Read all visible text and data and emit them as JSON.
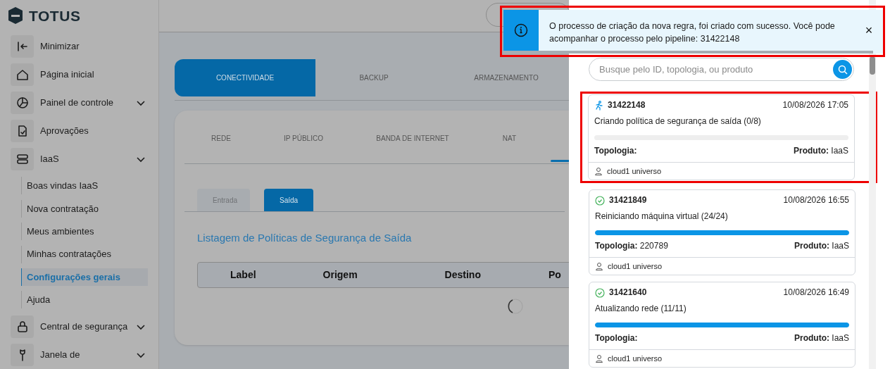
{
  "logo": {
    "text": "TOTUS"
  },
  "sidebar": {
    "items": [
      {
        "kind": "collapse",
        "label": "Minimizar",
        "expandable": false
      },
      {
        "kind": "home",
        "label": "Página inicial",
        "expandable": false
      },
      {
        "kind": "chart",
        "label": "Painel de controle",
        "expandable": true
      },
      {
        "kind": "approval",
        "label": "Aprovações",
        "expandable": false
      },
      {
        "kind": "server",
        "label": "IaaS",
        "expandable": true,
        "children": [
          {
            "label": "Boas vindas IaaS",
            "selected": false
          },
          {
            "label": "Nova contratação",
            "selected": false
          },
          {
            "label": "Meus ambientes",
            "selected": false
          },
          {
            "label": "Minhas contratações",
            "selected": false
          },
          {
            "label": "Configurações gerais",
            "selected": true
          },
          {
            "label": "Ajuda",
            "selected": false
          }
        ]
      },
      {
        "kind": "lock",
        "label": "Central de segurança",
        "expandable": true
      },
      {
        "kind": "wrench",
        "label": "Janela de",
        "expandable": true
      }
    ]
  },
  "main": {
    "tabs": [
      {
        "label": "CONECTIVIDADE",
        "selected": true
      },
      {
        "label": "BACKUP",
        "selected": false
      },
      {
        "label": "ARMAZENAMENTO",
        "selected": false
      }
    ],
    "sub_tabs": [
      {
        "label": "REDE",
        "selected": false
      },
      {
        "label": "IP PÚBLICO",
        "selected": false
      },
      {
        "label": "BANDA DE INTERNET",
        "selected": false
      },
      {
        "label": "NAT",
        "selected": false
      }
    ],
    "direction_tabs": [
      {
        "label": "Entrada",
        "selected": false
      },
      {
        "label": "Saída",
        "selected": true
      }
    ],
    "title": "Listagem de Políticas de Segurança de Saída",
    "table": {
      "columns": [
        "Label",
        "Origem",
        "Destino",
        "Po"
      ],
      "loading": true
    }
  },
  "toast": {
    "message": "O processo de criação da nova regra, foi criado com sucesso. Você pode acompanhar o processo pelo pipeline: 31422148",
    "close": "×",
    "highlighted": true
  },
  "pipeline_panel": {
    "search": {
      "placeholder": "Busque pelo ID, topologia, ou produto"
    },
    "jobs": [
      {
        "kind": "running",
        "id": "31422148",
        "date": "10/08/2026 17:05",
        "description": "Criando política de segurança de saída (0/8)",
        "level": 0,
        "topology_label": "Topologia:",
        "product_label": "Produto:",
        "product": "IaaS",
        "user": "cloud1 universo",
        "highlighted": true
      },
      {
        "kind": "done",
        "id": "31421849",
        "date": "10/08/2026 16:55",
        "description": "Reiniciando máquina virtual (24/24)",
        "level": 1,
        "topology_label": "Topologia:",
        "topology": "220789",
        "product_label": "Produto:",
        "product": "IaaS",
        "user": "cloud1 universo",
        "highlighted": false
      },
      {
        "kind": "done",
        "id": "31421640",
        "date": "10/08/2026 16:49",
        "description": "Atualizando rede (11/11)",
        "level": 1,
        "topology_label": "Topologia:",
        "product_label": "Produto:",
        "product": "IaaS",
        "user": "cloud1 universo",
        "highlighted": false
      }
    ]
  }
}
